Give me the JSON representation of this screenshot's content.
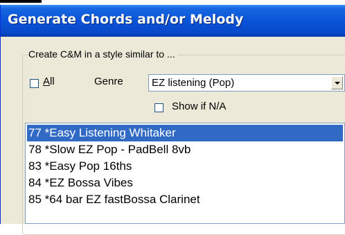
{
  "dialog": {
    "title": "Generate Chords and/or Melody"
  },
  "group": {
    "legend": "Create C&M in a style similar to ..."
  },
  "all_checkbox": {
    "label": "All",
    "checked": false
  },
  "genre": {
    "label": "Genre",
    "selected": "EZ listening (Pop)"
  },
  "show_na_checkbox": {
    "label": "Show if N/A",
    "checked": false
  },
  "style_list": {
    "selected_index": 0,
    "items": [
      "77 *Easy Listening Whitaker",
      "78 *Slow EZ Pop  - PadBell 8vb",
      "83 *Easy Pop 16ths",
      "84 *EZ Bossa Vibes",
      "85 *64 bar EZ fastBossa Clarinet"
    ]
  },
  "colors": {
    "title_bar": "#0a54d8",
    "selection": "#316ac5",
    "dialog_bg": "#ece9d8"
  },
  "icons": {
    "combo_arrow": "chevron-down-icon"
  }
}
